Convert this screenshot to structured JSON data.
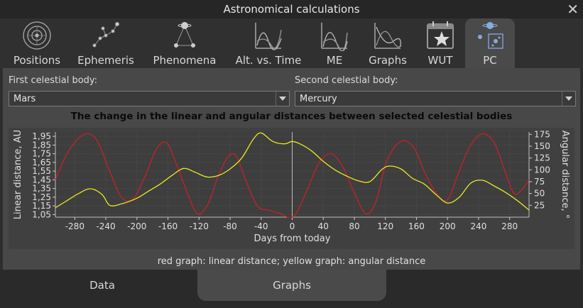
{
  "window": {
    "title": "Astronomical calculations",
    "close_label": "✕"
  },
  "tabs": [
    {
      "label": "Positions",
      "icon": "orbit-icon"
    },
    {
      "label": "Ephemeris",
      "icon": "constellation-icon"
    },
    {
      "label": "Phenomena",
      "icon": "phenomena-icon"
    },
    {
      "label": "Alt. vs. Time",
      "icon": "alt-time-chart-icon"
    },
    {
      "label": "ME",
      "icon": "me-chart-icon"
    },
    {
      "label": "Graphs",
      "icon": "graphs-icon"
    },
    {
      "label": "WUT",
      "icon": "calendar-star-icon"
    },
    {
      "label": "PC",
      "icon": "pc-planets-icon",
      "active": true
    }
  ],
  "first_body": {
    "label": "First celestial body:",
    "value": "Mars"
  },
  "second_body": {
    "label": "Second celestial body:",
    "value": "Mercury"
  },
  "chart_title": "The change in the linear and angular distances between selected celestial bodies",
  "legend_note": "red graph: linear distance; yellow graph: angular distance",
  "bottom_tabs": [
    {
      "label": "Data",
      "active": false
    },
    {
      "label": "Graphs",
      "active": true
    }
  ],
  "colors": {
    "linear": "#c8202a",
    "angular": "#e8e820",
    "background": "#404040"
  },
  "chart_data": {
    "type": "line",
    "xlabel": "Days from today",
    "ylabel_left": "Linear distance, AU",
    "ylabel_right": "Angular distance, °",
    "xlim": [
      -305,
      305
    ],
    "ylim_left": [
      1.02,
      2.0
    ],
    "ylim_right": [
      0,
      180
    ],
    "x_ticks": [
      -280,
      -240,
      -200,
      -160,
      -120,
      -80,
      -40,
      0,
      40,
      80,
      120,
      160,
      200,
      240,
      280
    ],
    "y_ticks_left": [
      "1,05",
      "1,15",
      "1,25",
      "1,35",
      "1,45",
      "1,55",
      "1,65",
      "1,75",
      "1,85",
      "1,95"
    ],
    "y_ticks_left_values": [
      1.05,
      1.15,
      1.25,
      1.35,
      1.45,
      1.55,
      1.65,
      1.75,
      1.85,
      1.95
    ],
    "y_ticks_right": [
      25,
      50,
      75,
      100,
      125,
      150,
      175
    ],
    "today_marker_x": 0,
    "grid": true,
    "series": [
      {
        "name": "linear distance",
        "axis": "left",
        "color": "#c8202a",
        "x": [
          -305,
          -290,
          -275,
          -262,
          -250,
          -235,
          -220,
          -205,
          -190,
          -175,
          -162,
          -150,
          -135,
          -122,
          -108,
          -95,
          -82,
          -72,
          -60,
          -45,
          -30,
          -15,
          -5,
          5,
          20,
          35,
          50,
          65,
          80,
          95,
          108,
          120,
          132,
          145,
          158,
          170,
          185,
          200,
          215,
          230,
          245,
          260,
          272,
          285,
          295,
          305
        ],
        "y": [
          1.45,
          1.75,
          1.93,
          1.98,
          1.88,
          1.55,
          1.25,
          1.23,
          1.48,
          1.8,
          1.88,
          1.65,
          1.3,
          1.06,
          1.18,
          1.5,
          1.72,
          1.72,
          1.45,
          1.15,
          1.1,
          1.06,
          1.02,
          1.06,
          1.35,
          1.65,
          1.75,
          1.6,
          1.3,
          1.06,
          1.2,
          1.62,
          1.83,
          1.9,
          1.8,
          1.55,
          1.3,
          1.22,
          1.55,
          1.85,
          1.98,
          1.88,
          1.6,
          1.3,
          1.33,
          1.45
        ]
      },
      {
        "name": "angular distance",
        "axis": "right",
        "color": "#e8e820",
        "x": [
          -305,
          -290,
          -275,
          -260,
          -245,
          -235,
          -220,
          -200,
          -185,
          -170,
          -155,
          -140,
          -125,
          -110,
          -95,
          -80,
          -65,
          -50,
          -40,
          -25,
          -10,
          0,
          10,
          25,
          40,
          55,
          70,
          85,
          100,
          115,
          125,
          140,
          155,
          170,
          185,
          200,
          215,
          230,
          245,
          260,
          275,
          290,
          305
        ],
        "y": [
          20,
          35,
          50,
          60,
          48,
          25,
          28,
          40,
          55,
          70,
          88,
          103,
          95,
          85,
          88,
          102,
          125,
          165,
          178,
          160,
          155,
          160,
          155,
          140,
          118,
          100,
          87,
          77,
          75,
          100,
          108,
          102,
          82,
          70,
          48,
          30,
          42,
          72,
          78,
          66,
          52,
          35,
          15
        ]
      }
    ]
  }
}
